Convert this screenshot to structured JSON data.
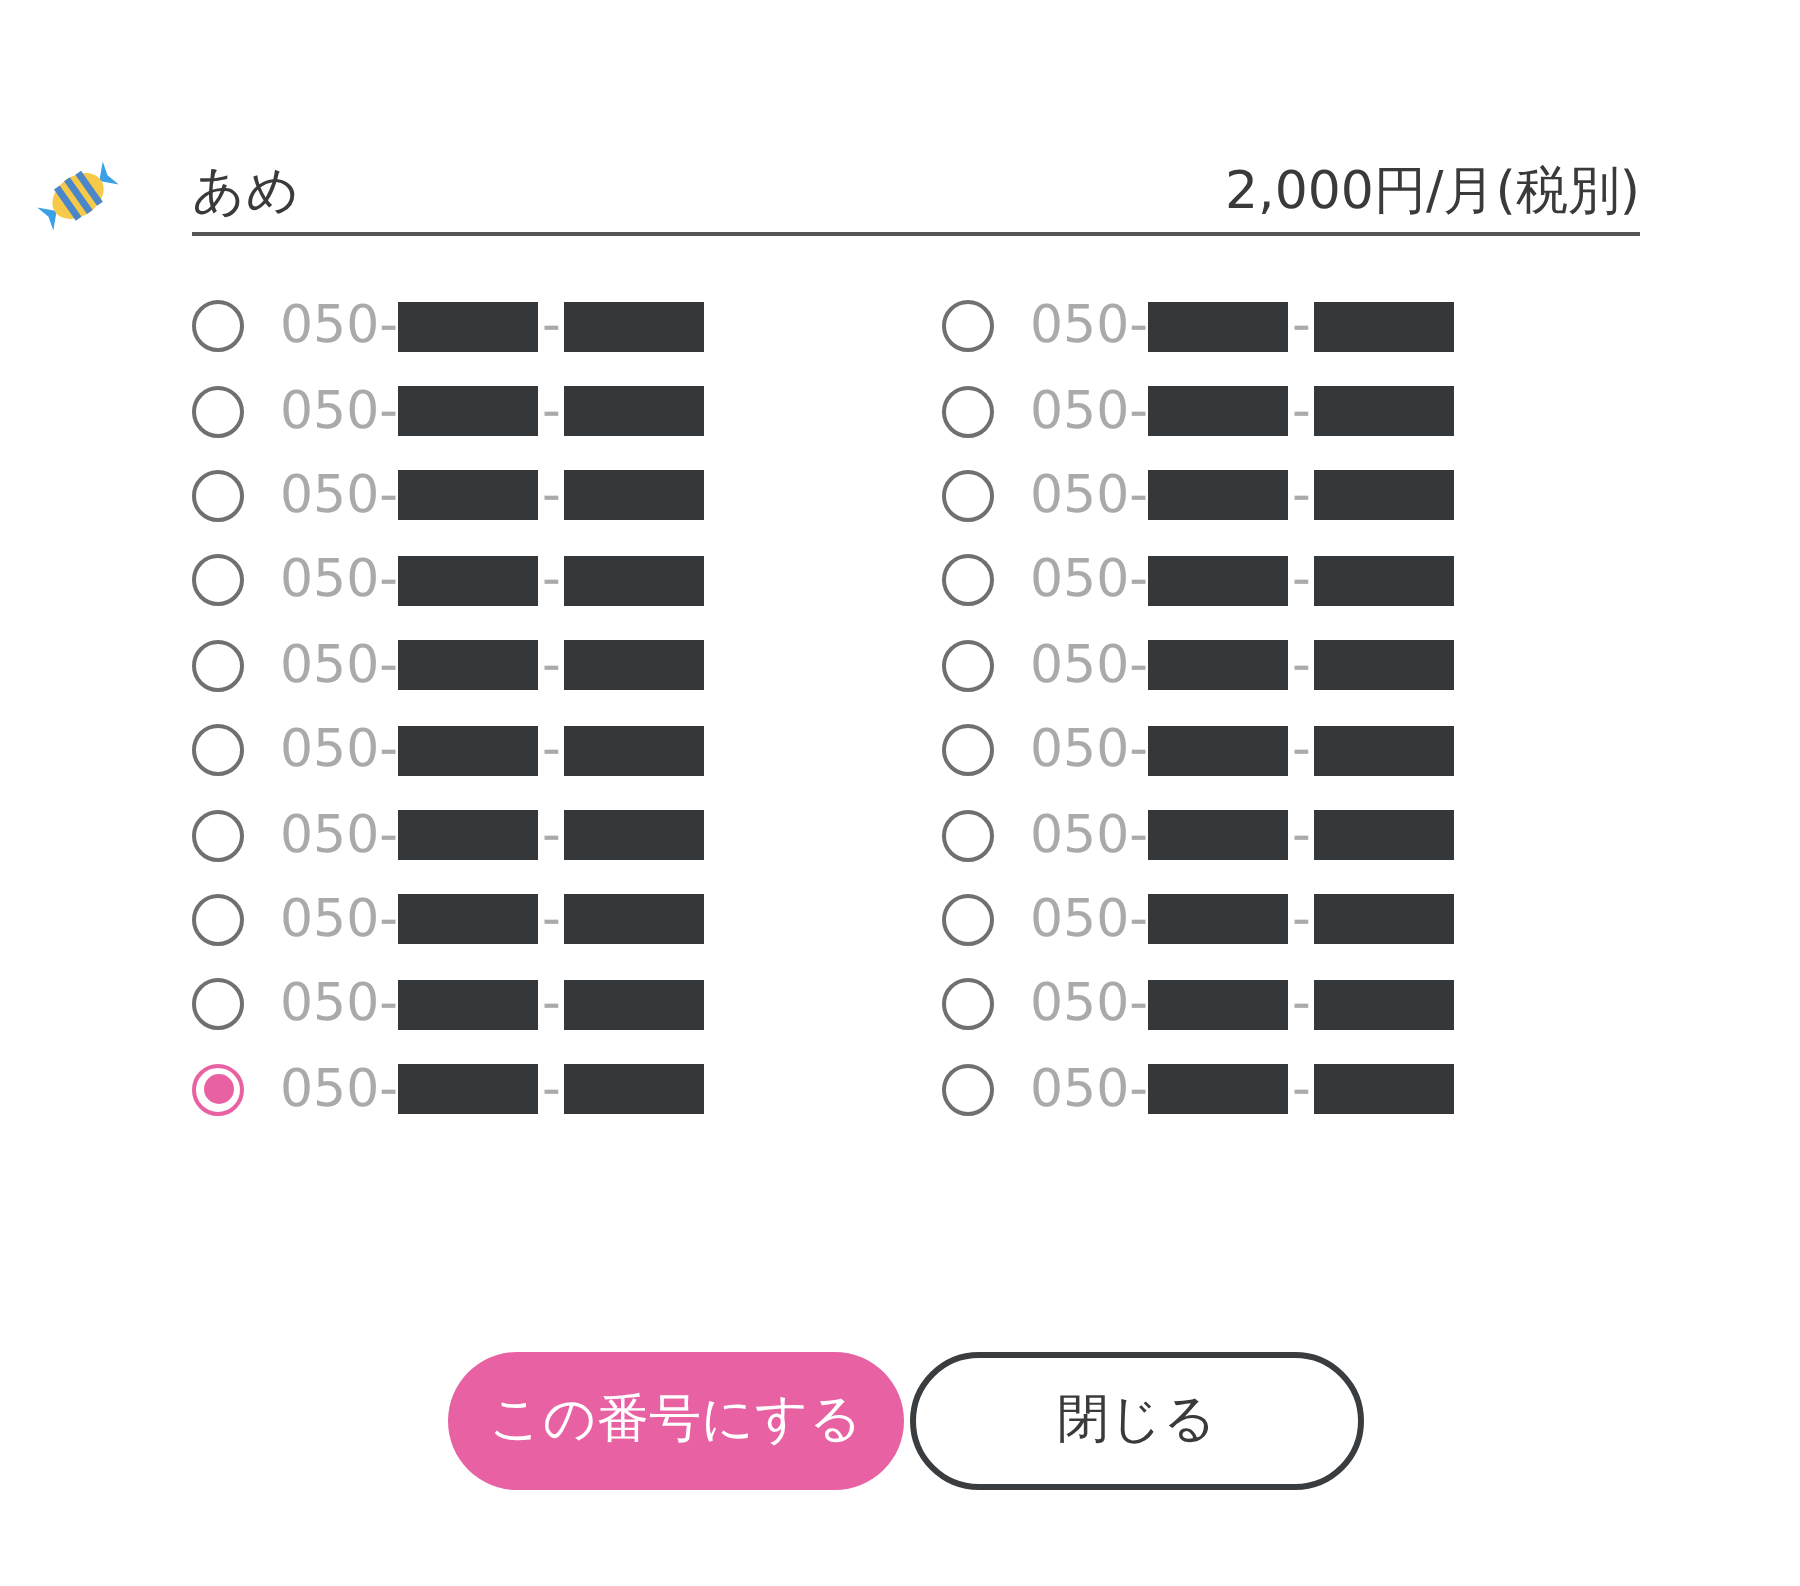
{
  "plan": {
    "name": "あめ",
    "price": "2,000円/月(税別)"
  },
  "number_columns": [
    {
      "options": [
        {
          "prefix": "050-",
          "separator": "-",
          "selected": false
        },
        {
          "prefix": "050-",
          "separator": "-",
          "selected": false
        },
        {
          "prefix": "050-",
          "separator": "-",
          "selected": false
        },
        {
          "prefix": "050-",
          "separator": "-",
          "selected": false
        },
        {
          "prefix": "050-",
          "separator": "-",
          "selected": false
        },
        {
          "prefix": "050-",
          "separator": "-",
          "selected": false
        },
        {
          "prefix": "050-",
          "separator": "-",
          "selected": false
        },
        {
          "prefix": "050-",
          "separator": "-",
          "selected": false
        },
        {
          "prefix": "050-",
          "separator": "-",
          "selected": false
        },
        {
          "prefix": "050-",
          "separator": "-",
          "selected": true
        }
      ]
    },
    {
      "options": [
        {
          "prefix": "050-",
          "separator": "-",
          "selected": false
        },
        {
          "prefix": "050-",
          "separator": "-",
          "selected": false
        },
        {
          "prefix": "050-",
          "separator": "-",
          "selected": false
        },
        {
          "prefix": "050-",
          "separator": "-",
          "selected": false
        },
        {
          "prefix": "050-",
          "separator": "-",
          "selected": false
        },
        {
          "prefix": "050-",
          "separator": "-",
          "selected": false
        },
        {
          "prefix": "050-",
          "separator": "-",
          "selected": false
        },
        {
          "prefix": "050-",
          "separator": "-",
          "selected": false
        },
        {
          "prefix": "050-",
          "separator": "-",
          "selected": false
        },
        {
          "prefix": "050-",
          "separator": "-",
          "selected": false
        }
      ]
    }
  ],
  "buttons": [
    {
      "kind": "primary",
      "label": "この番号にする"
    },
    {
      "kind": "outline",
      "label": "閉じる"
    }
  ]
}
